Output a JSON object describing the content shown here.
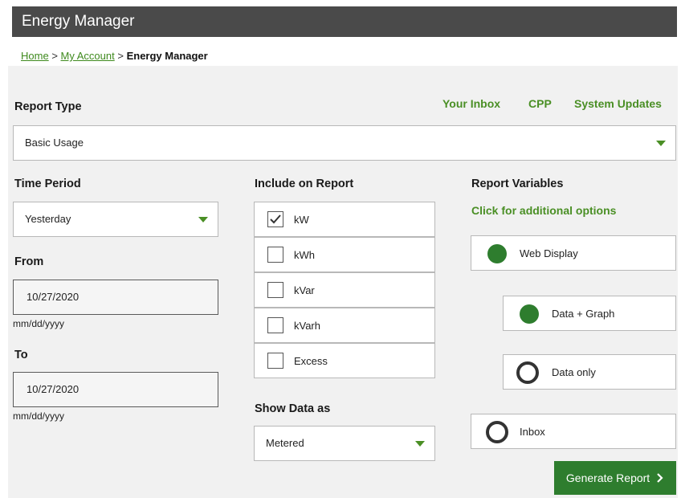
{
  "window": {
    "title": "Energy Manager"
  },
  "breadcrumb": {
    "home": "Home",
    "sep1": ">",
    "account": "My Account",
    "sep2": ">",
    "current": "Energy Manager"
  },
  "top_links": {
    "inbox": "Your Inbox",
    "cpp": "CPP",
    "updates": "System Updates"
  },
  "report_type": {
    "label": "Report Type",
    "value": "Basic Usage"
  },
  "time_period": {
    "label": "Time Period",
    "value": "Yesterday"
  },
  "from": {
    "label": "From",
    "value": "10/27/2020",
    "hint": "mm/dd/yyyy"
  },
  "to": {
    "label": "To",
    "value": "10/27/2020",
    "hint": "mm/dd/yyyy"
  },
  "include": {
    "label": "Include on Report",
    "items": [
      {
        "label": "kW",
        "checked": true
      },
      {
        "label": "kWh",
        "checked": false
      },
      {
        "label": "kVar",
        "checked": false
      },
      {
        "label": "kVarh",
        "checked": false
      },
      {
        "label": "Excess",
        "checked": false
      }
    ]
  },
  "show_data": {
    "label": "Show Data as",
    "value": "Metered"
  },
  "report_variables": {
    "label": "Report Variables",
    "more": "Click for additional options",
    "options": [
      {
        "label": "Web Display",
        "selected": true
      },
      {
        "label": "Data + Graph",
        "selected": true
      },
      {
        "label": "Data only",
        "selected": false
      },
      {
        "label": "Inbox",
        "selected": false
      }
    ]
  },
  "generate": {
    "label": "Generate Report",
    "icon": "chevron-right-icon"
  },
  "colors": {
    "accent": "#2e7d2e",
    "link": "#4a8f25",
    "titlebar": "#4a4a4a",
    "panel": "#f1f1f1"
  }
}
